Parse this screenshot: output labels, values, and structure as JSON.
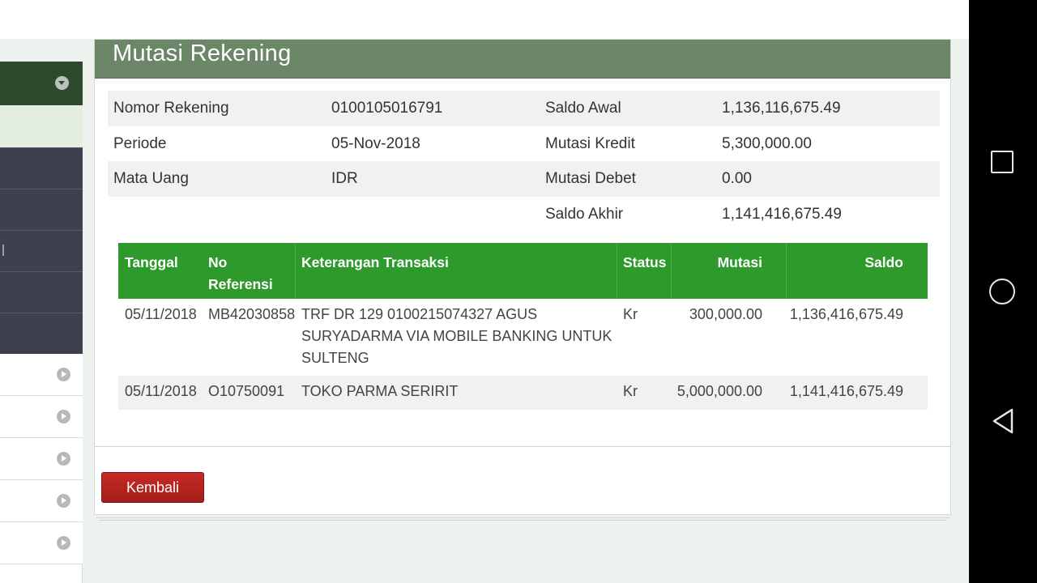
{
  "page": {
    "title": "Mutasi Rekening"
  },
  "account_info": {
    "rows": [
      {
        "label": "Nomor Rekening",
        "value": "0100105016791",
        "label2": "Saldo Awal",
        "value2": "1,136,116,675.49"
      },
      {
        "label": "Periode",
        "value": "05-Nov-2018",
        "label2": "Mutasi Kredit",
        "value2": "5,300,000.00"
      },
      {
        "label": "Mata Uang",
        "value": "IDR",
        "label2": "Mutasi Debet",
        "value2": "0.00"
      },
      {
        "label": "",
        "value": "",
        "label2": "Saldo Akhir",
        "value2": "1,141,416,675.49"
      }
    ]
  },
  "transactions": {
    "headers": {
      "tanggal": "Tanggal",
      "no_ref_line1": "No",
      "no_ref_line2": "Referensi",
      "keterangan": "Keterangan Transaksi",
      "status": "Status",
      "mutasi": "Mutasi",
      "saldo": "Saldo"
    },
    "rows": [
      {
        "tanggal": "05/11/2018",
        "no_referensi": "MB42030858",
        "keterangan": "TRF DR 129 0100215074327 AGUS SURYADARMA VIA MOBILE BANKING UNTUK SULTENG",
        "status": "Kr",
        "mutasi": "300,000.00",
        "saldo": "1,136,416,675.49"
      },
      {
        "tanggal": "05/11/2018",
        "no_referensi": "O10750091",
        "keterangan": "TOKO PARMA SERIRIT",
        "status": "Kr",
        "mutasi": "5,000,000.00",
        "saldo": "1,141,416,675.49"
      }
    ]
  },
  "actions": {
    "back_label": "Kembali"
  },
  "colors": {
    "header_green": "#6b8768",
    "table_header_green": "#2e9a2c",
    "button_red": "#b62320",
    "sidebar_dark": "#3d414d"
  },
  "icons": {
    "sidebar_toggle": "chevron-down-icon",
    "sidebar_item": "chevron-right-icon",
    "nav_recent": "recent-apps-icon",
    "nav_home": "home-icon",
    "nav_back": "back-icon"
  }
}
